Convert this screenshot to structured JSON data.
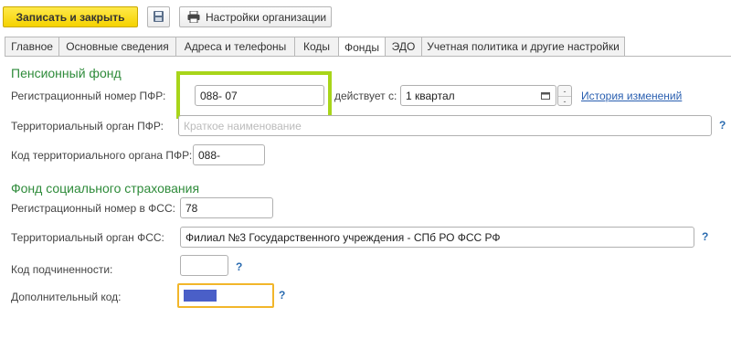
{
  "toolbar": {
    "save_close_label": "Записать и закрыть",
    "save_icon": "save-icon",
    "org_settings_label": "Настройки организации",
    "org_settings_icon": "printer-icon"
  },
  "tabs": [
    {
      "label": "Главное",
      "active": false
    },
    {
      "label": "Основные сведения",
      "active": false
    },
    {
      "label": "Адреса и телефоны",
      "active": false
    },
    {
      "label": "Коды",
      "active": false
    },
    {
      "label": "Фонды",
      "active": true
    },
    {
      "label": "ЭДО",
      "active": false
    },
    {
      "label": "Учетная политика и другие настройки",
      "active": false
    }
  ],
  "pfr": {
    "section_title": "Пенсионный фонд",
    "reg_number_label": "Регистрационный номер ПФР:",
    "reg_number_value": "088-       07",
    "valid_from_label": "действует с:",
    "valid_from_value": "1 квартал ",
    "history_link": "История изменений",
    "territorial_label": "Территориальный орган ПФР:",
    "territorial_placeholder": "Краткое наименование",
    "territorial_code_label": "Код территориального органа ПФР:",
    "territorial_code_value": "088-"
  },
  "fss": {
    "section_title": "Фонд социального страхования",
    "reg_number_label": "Регистрационный номер в ФСС:",
    "reg_number_value": "78",
    "territorial_label": "Территориальный орган ФСС:",
    "territorial_value": "Филиал №3   Государственного учреждения - СПб РО ФСС РФ",
    "subordination_label": "Код подчиненности:",
    "subordination_value": "",
    "additional_code_label": "Дополнительный код:"
  },
  "help_mark": "?",
  "colors": {
    "accent_green": "#2e8b3a",
    "highlight_green": "#a8d51a",
    "focus_orange": "#f2b62a",
    "redaction_blue": "#4a5fc8",
    "link_blue": "#2a5fb0"
  }
}
